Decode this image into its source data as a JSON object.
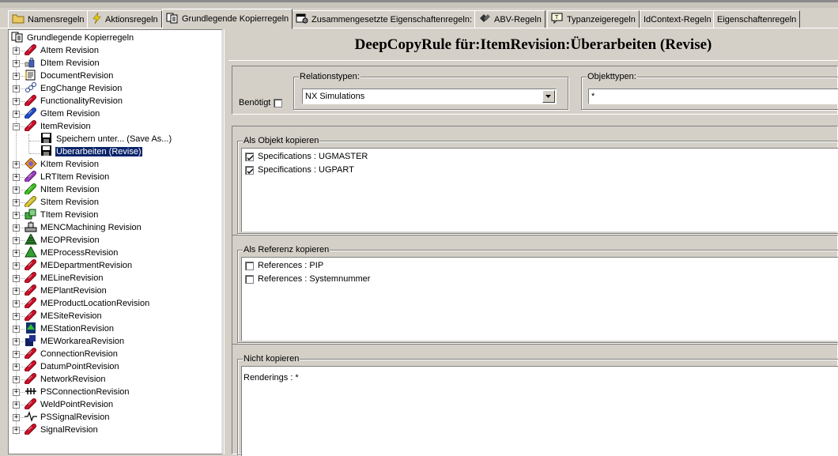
{
  "tabs": [
    {
      "label": "Namensregeln",
      "icon": "folder-icon"
    },
    {
      "label": "Aktionsregeln",
      "icon": "lightning-icon"
    },
    {
      "label": "Grundlegende Kopierregeln",
      "icon": "copy-icon",
      "active": true
    },
    {
      "label": "Zusammengesetzte Eigenschaftenregeln:",
      "icon": "properties-icon"
    },
    {
      "label": "ABV-Regeln",
      "icon": "diamond-icon"
    },
    {
      "label": "Typanzeigeregeln",
      "icon": "type-display-icon"
    },
    {
      "label": "IdContext-Regeln"
    },
    {
      "label": "Eigenschaftenregeln"
    }
  ],
  "tree": {
    "root": "Grundlegende Kopierregeln",
    "items": [
      {
        "label": "AItem Revision",
        "icon": "red-pill-icon"
      },
      {
        "label": "DItem Revision",
        "icon": "blue-figure-icon"
      },
      {
        "label": "DocumentRevision",
        "icon": "document-icon"
      },
      {
        "label": "EngChange Revision",
        "icon": "change-icon"
      },
      {
        "label": "FunctionalityRevision",
        "icon": "red-pill-icon"
      },
      {
        "label": "GItem Revision",
        "icon": "blue-pill-icon"
      },
      {
        "label": "ItemRevision",
        "icon": "red-pill-icon",
        "expanded": true,
        "children": [
          {
            "label": "Speichern unter... (Save As...)",
            "icon": "floppy-icon"
          },
          {
            "label": "Überarbeiten (Revise)",
            "icon": "floppy-icon",
            "selected": true
          }
        ]
      },
      {
        "label": "KItem Revision",
        "icon": "orange-diamond-icon"
      },
      {
        "label": "LRTItem Revision",
        "icon": "purple-pill-icon"
      },
      {
        "label": "NItem Revision",
        "icon": "green-pill-icon"
      },
      {
        "label": "SItem Revision",
        "icon": "yellow-pill-icon"
      },
      {
        "label": "TItem Revision",
        "icon": "green-boxes-icon"
      },
      {
        "label": "MENCMachining Revision",
        "icon": "machine-icon"
      },
      {
        "label": "MEOPRevision",
        "icon": "green-tree-icon"
      },
      {
        "label": "MEProcessRevision",
        "icon": "green-triangle-icon"
      },
      {
        "label": "MEDepartmentRevision",
        "icon": "red-pill-icon"
      },
      {
        "label": "MELineRevision",
        "icon": "red-pill-icon"
      },
      {
        "label": "MEPlantRevision",
        "icon": "red-pill-icon"
      },
      {
        "label": "MEProductLocationRevision",
        "icon": "red-pill-icon"
      },
      {
        "label": "MESiteRevision",
        "icon": "red-pill-icon"
      },
      {
        "label": "MEStationRevision",
        "icon": "station-icon"
      },
      {
        "label": "MEWorkareaRevision",
        "icon": "workarea-icon"
      },
      {
        "label": "ConnectionRevision",
        "icon": "red-pill-icon"
      },
      {
        "label": "DatumPointRevision",
        "icon": "red-pill-icon"
      },
      {
        "label": "NetworkRevision",
        "icon": "red-pill-icon"
      },
      {
        "label": "PSConnectionRevision",
        "icon": "ps-connection-icon"
      },
      {
        "label": "WeldPointRevision",
        "icon": "red-pill-icon"
      },
      {
        "label": "PSSignalRevision",
        "icon": "signal-icon"
      },
      {
        "label": "SignalRevision",
        "icon": "red-pill-icon"
      }
    ]
  },
  "main": {
    "title": "DeepCopyRule für:ItemRevision:Überarbeiten (Revise)",
    "required_label": "Benötigt",
    "required_checked": false,
    "relation_types_label": "Relationstypen:",
    "relation_types_value": "NX Simulations",
    "object_types_label": "Objekttypen:",
    "object_types_value": "*",
    "copy_as_object": {
      "label": "Als Objekt kopieren",
      "items": [
        {
          "label": "Specifications : UGMASTER",
          "checked": true
        },
        {
          "label": "Specifications : UGPART",
          "checked": true
        }
      ]
    },
    "copy_as_reference": {
      "label": "Als Referenz kopieren",
      "items": [
        {
          "label": "References : PIP",
          "checked": false
        },
        {
          "label": "References : Systemnummer",
          "checked": false
        }
      ]
    },
    "dont_copy": {
      "label": "Nicht kopieren",
      "items": [
        "Renderings : *"
      ]
    }
  },
  "colors": {
    "window_bg": "#d4d0c8",
    "selection_bg": "#0a246a",
    "red_icon": "#c8102e"
  }
}
